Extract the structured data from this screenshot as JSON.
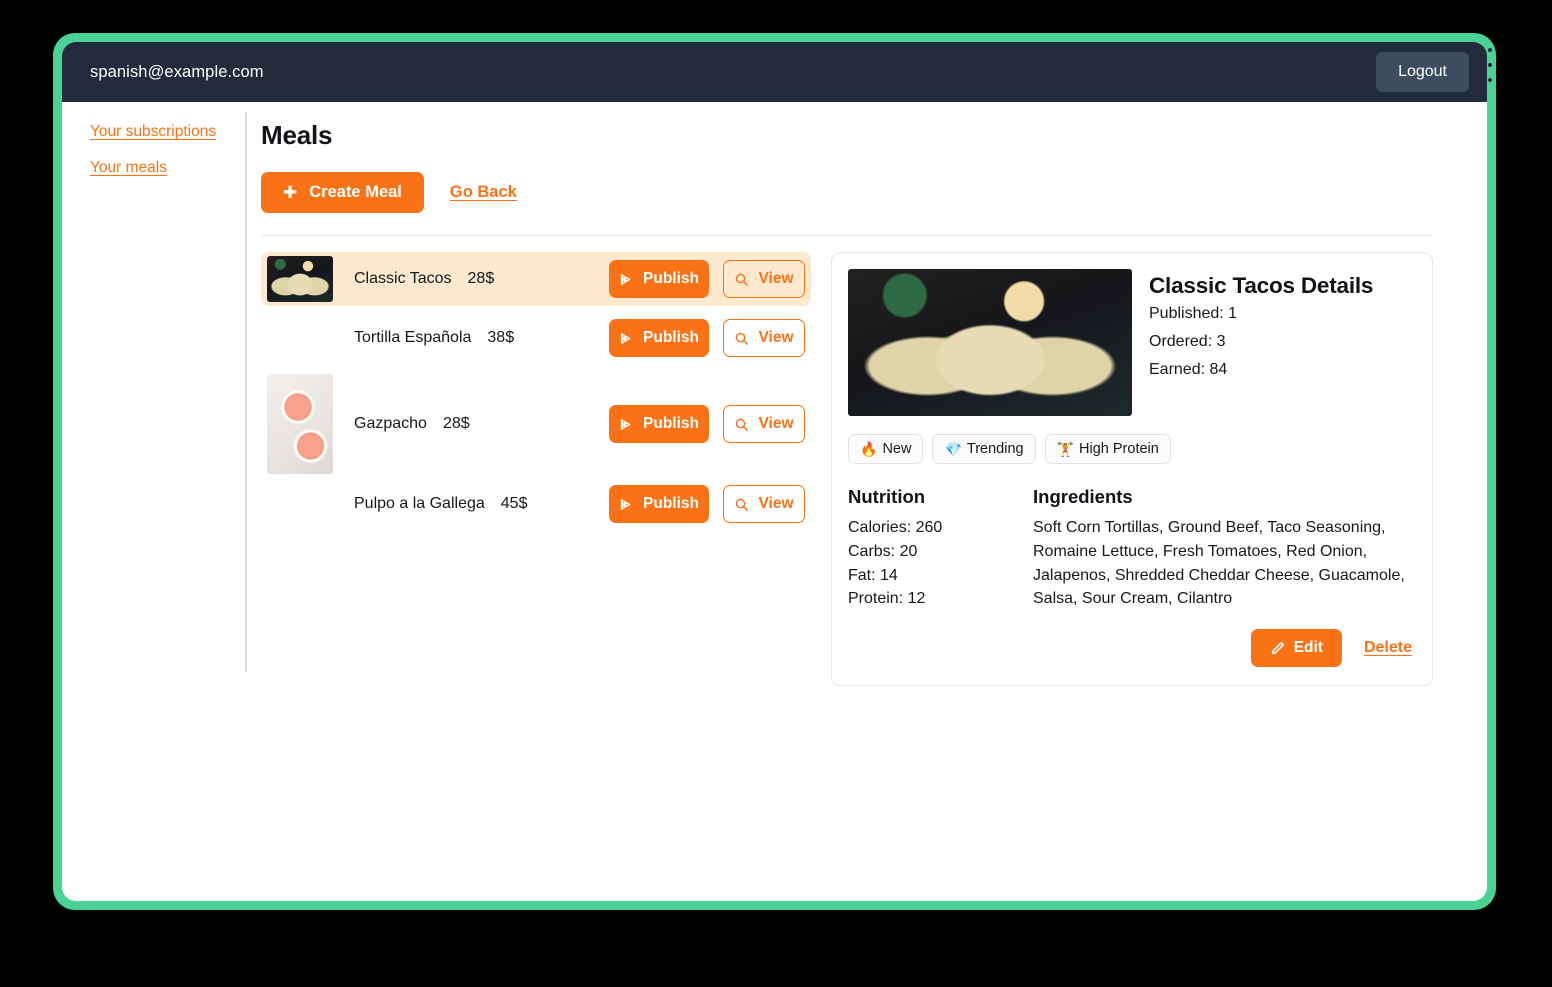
{
  "window": {
    "frame_color": "#4ad295",
    "topbar_color": "#212b3b",
    "accent_color": "#f97316",
    "selected_row_color": "#fde9cf"
  },
  "topbar": {
    "user_email": "spanish@example.com",
    "logout_label": "Logout"
  },
  "sidebar": {
    "items": [
      {
        "label": "Your subscriptions",
        "name": "sidebar-item-your-subscriptions"
      },
      {
        "label": "Your meals",
        "name": "sidebar-item-your-meals"
      }
    ]
  },
  "main": {
    "page_title": "Meals",
    "create_meal_label": "Create Meal",
    "create_meal_icon": "plus-icon",
    "go_back_label": "Go Back"
  },
  "meal_list": {
    "publish_label": "Publish",
    "publish_icon": "pizza-slice-icon",
    "view_label": "View",
    "view_icon": "search-icon",
    "rows": [
      {
        "name": "Classic Tacos",
        "price": "28$",
        "selected": true,
        "thumb_height": 46,
        "thumb": "tacos"
      },
      {
        "name": "Tortilla Española",
        "price": "38$",
        "selected": false,
        "thumb_height": 56,
        "thumb": "tortilla"
      },
      {
        "name": "Gazpacho",
        "price": "28$",
        "selected": false,
        "thumb_height": 100,
        "thumb": "gazpacho"
      },
      {
        "name": "Pulpo a la Gallega",
        "price": "45$",
        "selected": false,
        "thumb_height": 44,
        "thumb": "pulpo"
      }
    ]
  },
  "detail": {
    "title": "Classic Tacos Details",
    "published": "Published: 1",
    "ordered": "Ordered: 3",
    "earned": "Earned: 84",
    "tags": [
      {
        "emoji": "🔥",
        "label": "New",
        "icon_name": "fire-emoji-icon"
      },
      {
        "emoji": "💎",
        "label": "Trending",
        "icon_name": "gem-emoji-icon"
      },
      {
        "emoji": "🏋️",
        "label": "High Protein",
        "icon_name": "weightlifter-emoji-icon"
      }
    ],
    "nutrition_heading": "Nutrition",
    "nutrition_lines": [
      "Calories: 260",
      "Carbs: 20",
      "Fat: 14",
      "Protein: 12"
    ],
    "ingredients_heading": "Ingredients",
    "ingredients": "Soft Corn Tortillas, Ground Beef, Taco Seasoning, Romaine Lettuce, Fresh Tomatoes, Red Onion, Jalapenos, Shredded Cheddar Cheese, Guacamole, Salsa, Sour Cream, Cilantro",
    "edit_label": "Edit",
    "edit_icon": "pencil-icon",
    "delete_label": "Delete"
  }
}
